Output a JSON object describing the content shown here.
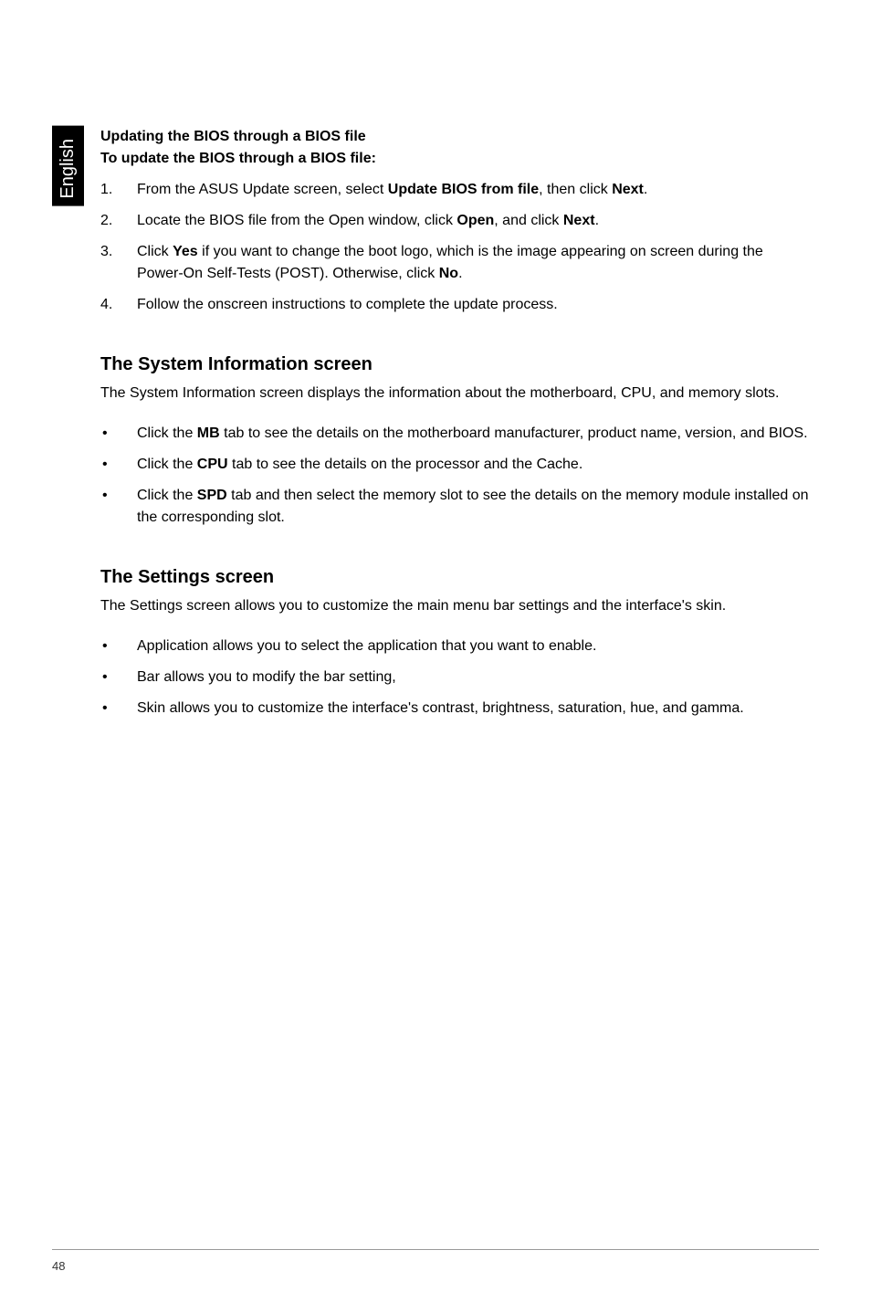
{
  "sideTab": "English",
  "headings": {
    "updating": "Updating the BIOS through a BIOS file",
    "toUpdate": "To update the BIOS through a BIOS file:",
    "sysInfo": "The System Information screen",
    "settings": "The Settings screen"
  },
  "steps": {
    "s1": {
      "num": "1.",
      "pre": "From the ASUS Update screen, select ",
      "b1": "Update BIOS from file",
      "mid": ", then click ",
      "b2": "Next",
      "post": "."
    },
    "s2": {
      "num": "2.",
      "pre": "Locate the BIOS file from the Open window, click ",
      "b1": "Open",
      "mid": ", and click ",
      "b2": "Next",
      "post": "."
    },
    "s3": {
      "num": "3.",
      "pre": "Click ",
      "b1": "Yes",
      "mid": " if you want to change the boot logo, which is the image appearing on screen during the Power-On Self-Tests (POST). Otherwise, click ",
      "b2": "No",
      "post": "."
    },
    "s4": {
      "num": "4.",
      "text": "Follow the onscreen instructions to complete the update process."
    }
  },
  "sysInfoPara": "The System Information screen displays the information about the motherboard, CPU, and memory slots.",
  "sysInfoBullets": {
    "b1": {
      "pre": "Click the ",
      "b": "MB",
      "post": " tab to see the details on the motherboard manufacturer, product name, version, and BIOS."
    },
    "b2": {
      "pre": "Click the ",
      "b": "CPU",
      "post": " tab to see the details on the processor and the Cache."
    },
    "b3": {
      "pre": "Click the ",
      "b": "SPD",
      "post": " tab and then select the memory slot to see the details on the memory module installed on the corresponding slot."
    }
  },
  "settingsPara": "The Settings screen allows you to customize the main menu bar settings and the interface's skin.",
  "settingsBullets": {
    "b1": "Application allows you to select the application that you want to enable.",
    "b2": "Bar allows you to modify the bar setting,",
    "b3": "Skin allows you to customize the interface's contrast, brightness, saturation, hue, and gamma."
  },
  "pageNumber": "48",
  "bulletChar": "•"
}
